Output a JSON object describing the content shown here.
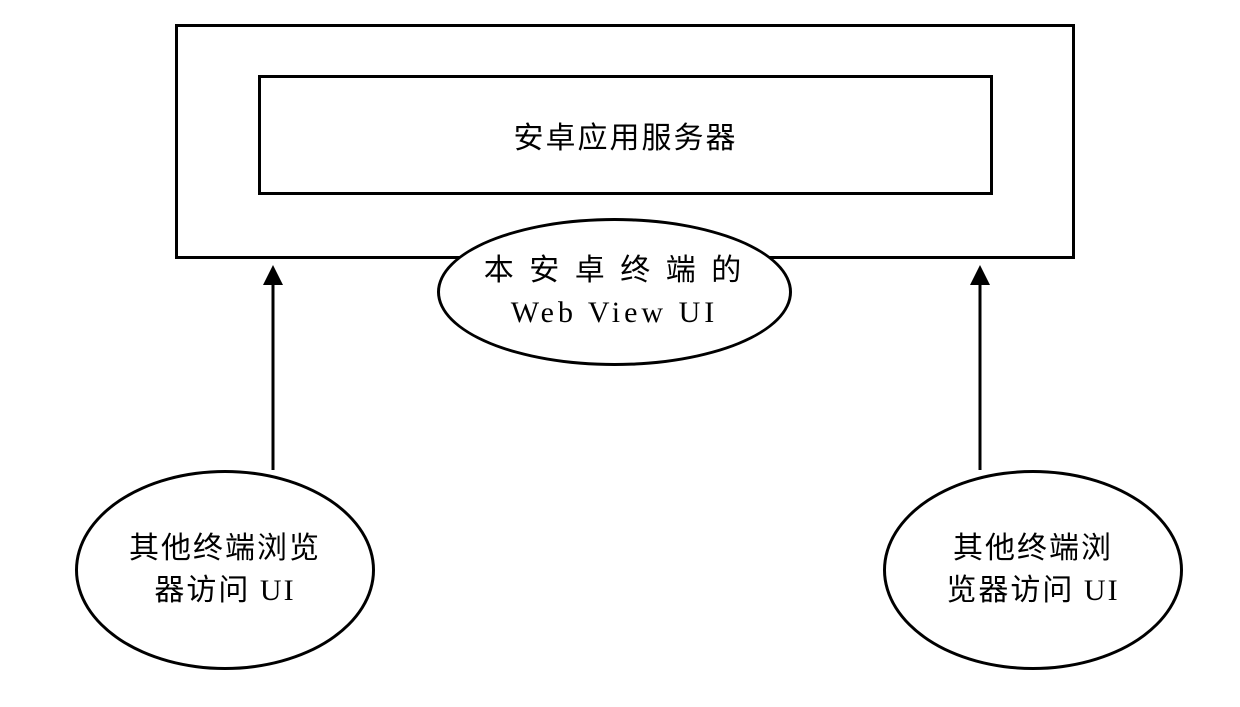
{
  "diagram": {
    "inner_box_label": "安卓应用服务器",
    "center_ellipse_line1": "本 安 卓 终 端 的",
    "center_ellipse_line2": "Web View UI",
    "left_ellipse_line1": "其他终端浏览",
    "left_ellipse_line2": "器访问 UI",
    "right_ellipse_line1": "其他终端浏",
    "right_ellipse_line2": "览器访问 UI"
  }
}
